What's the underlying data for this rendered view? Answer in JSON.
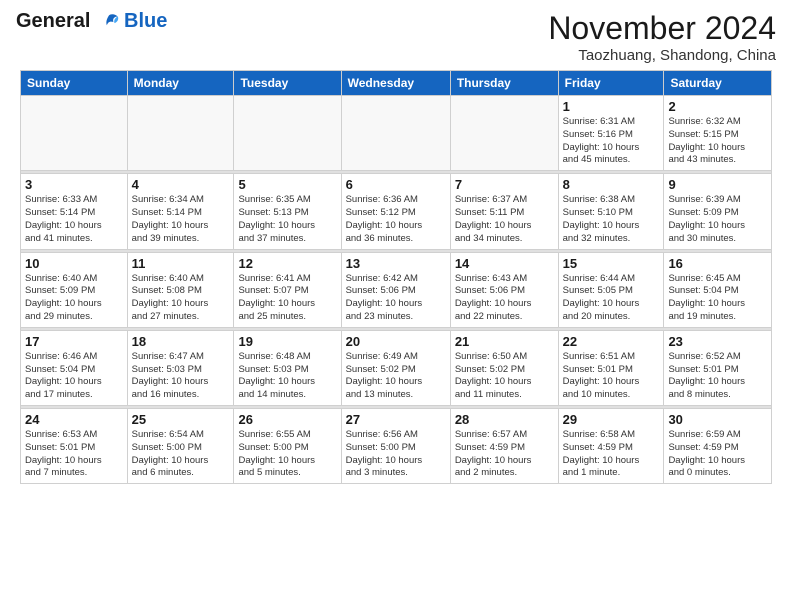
{
  "header": {
    "logo_line1": "General",
    "logo_line2": "Blue",
    "month": "November 2024",
    "location": "Taozhuang, Shandong, China"
  },
  "days_of_week": [
    "Sunday",
    "Monday",
    "Tuesday",
    "Wednesday",
    "Thursday",
    "Friday",
    "Saturday"
  ],
  "weeks": [
    [
      {
        "day": "",
        "info": ""
      },
      {
        "day": "",
        "info": ""
      },
      {
        "day": "",
        "info": ""
      },
      {
        "day": "",
        "info": ""
      },
      {
        "day": "",
        "info": ""
      },
      {
        "day": "1",
        "info": "Sunrise: 6:31 AM\nSunset: 5:16 PM\nDaylight: 10 hours\nand 45 minutes."
      },
      {
        "day": "2",
        "info": "Sunrise: 6:32 AM\nSunset: 5:15 PM\nDaylight: 10 hours\nand 43 minutes."
      }
    ],
    [
      {
        "day": "3",
        "info": "Sunrise: 6:33 AM\nSunset: 5:14 PM\nDaylight: 10 hours\nand 41 minutes."
      },
      {
        "day": "4",
        "info": "Sunrise: 6:34 AM\nSunset: 5:14 PM\nDaylight: 10 hours\nand 39 minutes."
      },
      {
        "day": "5",
        "info": "Sunrise: 6:35 AM\nSunset: 5:13 PM\nDaylight: 10 hours\nand 37 minutes."
      },
      {
        "day": "6",
        "info": "Sunrise: 6:36 AM\nSunset: 5:12 PM\nDaylight: 10 hours\nand 36 minutes."
      },
      {
        "day": "7",
        "info": "Sunrise: 6:37 AM\nSunset: 5:11 PM\nDaylight: 10 hours\nand 34 minutes."
      },
      {
        "day": "8",
        "info": "Sunrise: 6:38 AM\nSunset: 5:10 PM\nDaylight: 10 hours\nand 32 minutes."
      },
      {
        "day": "9",
        "info": "Sunrise: 6:39 AM\nSunset: 5:09 PM\nDaylight: 10 hours\nand 30 minutes."
      }
    ],
    [
      {
        "day": "10",
        "info": "Sunrise: 6:40 AM\nSunset: 5:09 PM\nDaylight: 10 hours\nand 29 minutes."
      },
      {
        "day": "11",
        "info": "Sunrise: 6:40 AM\nSunset: 5:08 PM\nDaylight: 10 hours\nand 27 minutes."
      },
      {
        "day": "12",
        "info": "Sunrise: 6:41 AM\nSunset: 5:07 PM\nDaylight: 10 hours\nand 25 minutes."
      },
      {
        "day": "13",
        "info": "Sunrise: 6:42 AM\nSunset: 5:06 PM\nDaylight: 10 hours\nand 23 minutes."
      },
      {
        "day": "14",
        "info": "Sunrise: 6:43 AM\nSunset: 5:06 PM\nDaylight: 10 hours\nand 22 minutes."
      },
      {
        "day": "15",
        "info": "Sunrise: 6:44 AM\nSunset: 5:05 PM\nDaylight: 10 hours\nand 20 minutes."
      },
      {
        "day": "16",
        "info": "Sunrise: 6:45 AM\nSunset: 5:04 PM\nDaylight: 10 hours\nand 19 minutes."
      }
    ],
    [
      {
        "day": "17",
        "info": "Sunrise: 6:46 AM\nSunset: 5:04 PM\nDaylight: 10 hours\nand 17 minutes."
      },
      {
        "day": "18",
        "info": "Sunrise: 6:47 AM\nSunset: 5:03 PM\nDaylight: 10 hours\nand 16 minutes."
      },
      {
        "day": "19",
        "info": "Sunrise: 6:48 AM\nSunset: 5:03 PM\nDaylight: 10 hours\nand 14 minutes."
      },
      {
        "day": "20",
        "info": "Sunrise: 6:49 AM\nSunset: 5:02 PM\nDaylight: 10 hours\nand 13 minutes."
      },
      {
        "day": "21",
        "info": "Sunrise: 6:50 AM\nSunset: 5:02 PM\nDaylight: 10 hours\nand 11 minutes."
      },
      {
        "day": "22",
        "info": "Sunrise: 6:51 AM\nSunset: 5:01 PM\nDaylight: 10 hours\nand 10 minutes."
      },
      {
        "day": "23",
        "info": "Sunrise: 6:52 AM\nSunset: 5:01 PM\nDaylight: 10 hours\nand 8 minutes."
      }
    ],
    [
      {
        "day": "24",
        "info": "Sunrise: 6:53 AM\nSunset: 5:01 PM\nDaylight: 10 hours\nand 7 minutes."
      },
      {
        "day": "25",
        "info": "Sunrise: 6:54 AM\nSunset: 5:00 PM\nDaylight: 10 hours\nand 6 minutes."
      },
      {
        "day": "26",
        "info": "Sunrise: 6:55 AM\nSunset: 5:00 PM\nDaylight: 10 hours\nand 5 minutes."
      },
      {
        "day": "27",
        "info": "Sunrise: 6:56 AM\nSunset: 5:00 PM\nDaylight: 10 hours\nand 3 minutes."
      },
      {
        "day": "28",
        "info": "Sunrise: 6:57 AM\nSunset: 4:59 PM\nDaylight: 10 hours\nand 2 minutes."
      },
      {
        "day": "29",
        "info": "Sunrise: 6:58 AM\nSunset: 4:59 PM\nDaylight: 10 hours\nand 1 minute."
      },
      {
        "day": "30",
        "info": "Sunrise: 6:59 AM\nSunset: 4:59 PM\nDaylight: 10 hours\nand 0 minutes."
      }
    ]
  ]
}
